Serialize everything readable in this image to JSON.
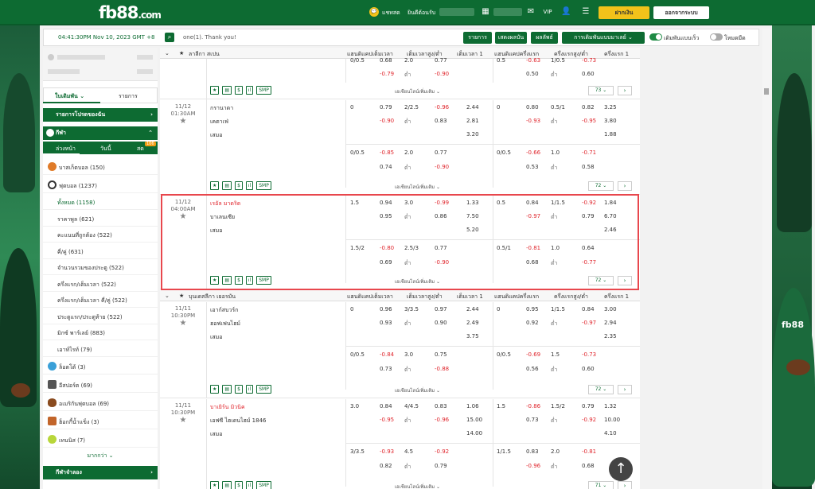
{
  "topbar": {
    "logo": "fb88",
    "logo_suffix": ".com",
    "chat_label": "แชทสด",
    "account_label": "ยินดีต้อนรับ",
    "deposit_label": "ฝากเงิน",
    "logout_label": "ออกจากระบบ"
  },
  "toolbar": {
    "time": "04:41:30PM Nov 10, 2023 GMT +8",
    "message": "one(1). Thank you!",
    "btn_list": "รายการ",
    "btn_results": "เสดงผลบัน",
    "btn_stats": "ผลลัพธ์",
    "btn_sort": "การเดิมพันแบบมาเลย์",
    "toggle_quick": "เดิมพันแบบเร็ว",
    "toggle_dark": "โหมดมืด"
  },
  "left": {
    "tab_bet": "ใบเดิมพัน",
    "tab_list": "รายการ",
    "fav_label": "รายการโปรดของฉัน",
    "sports_label": "กีฬา",
    "sub_tabs": [
      "ล่วงหน้า",
      "วันนี้",
      "สด"
    ],
    "live_badge": "106",
    "sports": [
      {
        "label": "บาสเก็ตบอล",
        "count": "(150)"
      },
      {
        "label": "ฟุตบอล",
        "count": "(1237)"
      }
    ],
    "football_sub": [
      {
        "label": "ทั้งหมด",
        "count": "(1158)"
      },
      {
        "label": "ราคาพูล",
        "count": "(621)"
      },
      {
        "label": "คะแนนที่ถูกต้อง",
        "count": "(522)"
      },
      {
        "label": "คี่/คู่",
        "count": "(631)"
      },
      {
        "label": "จำนวนรวมของประตู",
        "count": "(522)"
      },
      {
        "label": "ครึ่งแรก/เต็มเวลา",
        "count": "(522)"
      },
      {
        "label": "ครึ่งแรก/เต็มเวลา คี่/คู่",
        "count": "(522)"
      },
      {
        "label": "ประตูแรก/ประตูท้าย",
        "count": "(522)"
      },
      {
        "label": "มิกซ์ พาร์เลย์",
        "count": "(883)"
      },
      {
        "label": "เอาท์ไรท์",
        "count": "(79)"
      }
    ],
    "other_sports": [
      {
        "label": "ล็อตโต้",
        "count": "(3)"
      },
      {
        "label": "อีสปอร์ต",
        "count": "(69)"
      },
      {
        "label": "อเมริกันฟุตบอล",
        "count": "(69)"
      },
      {
        "label": "ฮ็อกกี้น้ำแข็ง",
        "count": "(3)"
      },
      {
        "label": "เทนนิส",
        "count": "(7)"
      }
    ],
    "more": "มากกว่า",
    "virtual_label": "กีฬาจำลอง"
  },
  "headers": [
    "แฮนดิแคปเต็มเวลา",
    "เต็มเวลาสูง/ต่ำ",
    "เต็มเวลา 1",
    "แฮนดิแคปครึ่งแรก",
    "ครึ่งแรกสูง/ต่ำ",
    "ครึ่งแรก 1"
  ],
  "league1": "ลาลีกา สเปน",
  "league2": "บุนเดสลีกา เยอรมัน",
  "more_bets": "เอเชียนไลน์เพิ่มเติม",
  "under": "ต่ำ",
  "draw": "เสมอ",
  "icons": [
    "★",
    "▤",
    "$",
    "ıl",
    "SMP"
  ],
  "rows": [
    {
      "date": "",
      "time": "",
      "home": "",
      "away": "",
      "lines": [
        [
          "0/0.5",
          "0.68",
          "2.0",
          "0.77",
          "",
          "0.5",
          "-0.63",
          "1/0.5",
          "-0.73",
          ""
        ],
        [
          "",
          "-0.79",
          "ต่ำ",
          "-0.90",
          "",
          "",
          "0.50",
          "ต่ำ",
          "0.60",
          ""
        ]
      ],
      "markets": "73"
    },
    {
      "date": "11/12",
      "time": "01:30AM",
      "home": "กรานาดา",
      "away": "เคตาเฟ่",
      "lines": [
        [
          "0",
          "0.79",
          "2/2.5",
          "-0.96",
          "2.44",
          "0",
          "0.80",
          "0.5/1",
          "0.82",
          "3.25"
        ],
        [
          "",
          "-0.90",
          "ต่ำ",
          "0.83",
          "2.81",
          "",
          "-0.93",
          "ต่ำ",
          "-0.95",
          "3.80"
        ],
        [
          "",
          "",
          "",
          "",
          "3.20",
          "",
          "",
          "",
          "",
          "1.88"
        ],
        [
          "0/0.5",
          "-0.85",
          "2.0",
          "0.77",
          "",
          "0/0.5",
          "-0.66",
          "1.0",
          "-0.71",
          ""
        ],
        [
          "",
          "0.74",
          "ต่ำ",
          "-0.90",
          "",
          "",
          "0.53",
          "ต่ำ",
          "0.58",
          ""
        ]
      ],
      "markets": "72"
    },
    {
      "date": "11/12",
      "time": "04:00AM",
      "home": "เรอัล มาดริด",
      "away": "บาเลนเซีย",
      "lines": [
        [
          "1.5",
          "0.94",
          "3.0",
          "-0.99",
          "1.33",
          "0.5",
          "0.84",
          "1/1.5",
          "-0.92",
          "1.84"
        ],
        [
          "",
          "0.95",
          "ต่ำ",
          "0.86",
          "7.50",
          "",
          "-0.97",
          "ต่ำ",
          "0.79",
          "6.70"
        ],
        [
          "",
          "",
          "",
          "",
          "5.20",
          "",
          "",
          "",
          "",
          "2.46"
        ],
        [
          "1.5/2",
          "-0.80",
          "2.5/3",
          "0.77",
          "",
          "0.5/1",
          "-0.81",
          "1.0",
          "0.64",
          ""
        ],
        [
          "",
          "0.69",
          "ต่ำ",
          "-0.90",
          "",
          "",
          "0.68",
          "ต่ำ",
          "-0.77",
          ""
        ]
      ],
      "markets": "72"
    },
    {
      "date": "11/11",
      "time": "10:30PM",
      "home": "เอาก์สบวร์ก",
      "away": "ฮอฟเฟนไฮม์",
      "lines": [
        [
          "0",
          "0.96",
          "3/3.5",
          "0.97",
          "2.44",
          "0",
          "0.95",
          "1/1.5",
          "0.84",
          "3.00"
        ],
        [
          "",
          "0.93",
          "ต่ำ",
          "0.90",
          "2.49",
          "",
          "0.92",
          "ต่ำ",
          "-0.97",
          "2.94"
        ],
        [
          "",
          "",
          "",
          "",
          "3.75",
          "",
          "",
          "",
          "",
          "2.35"
        ],
        [
          "0/0.5",
          "-0.84",
          "3.0",
          "0.75",
          "",
          "0/0.5",
          "-0.69",
          "1.5",
          "-0.73",
          ""
        ],
        [
          "",
          "0.73",
          "ต่ำ",
          "-0.88",
          "",
          "",
          "0.56",
          "ต่ำ",
          "0.60",
          ""
        ]
      ],
      "markets": "72"
    },
    {
      "date": "11/11",
      "time": "10:30PM",
      "home": "บาเยิร์น มิวนิค",
      "away": "เอฟซี ไฮเดนไฮม์ 1846",
      "lines": [
        [
          "3.0",
          "0.84",
          "4/4.5",
          "0.83",
          "1.06",
          "1.5",
          "-0.86",
          "1.5/2",
          "0.79",
          "1.32"
        ],
        [
          "",
          "-0.95",
          "ต่ำ",
          "-0.96",
          "15.00",
          "",
          "0.73",
          "ต่ำ",
          "-0.92",
          "10.00"
        ],
        [
          "",
          "",
          "",
          "",
          "14.00",
          "",
          "",
          "",
          "",
          "4.10"
        ],
        [
          "3/3.5",
          "-0.93",
          "4.5",
          "-0.92",
          "",
          "1/1.5",
          "0.83",
          "2.0",
          "-0.81",
          ""
        ],
        [
          "",
          "0.82",
          "ต่ำ",
          "0.79",
          "",
          "",
          "-0.96",
          "ต่ำ",
          "0.68",
          ""
        ]
      ],
      "markets": "71"
    }
  ],
  "colors": {
    "brand": "#0d6b32",
    "accent": "#f2c21a",
    "negative": "#e0262d",
    "highlight": "#e8474d"
  }
}
